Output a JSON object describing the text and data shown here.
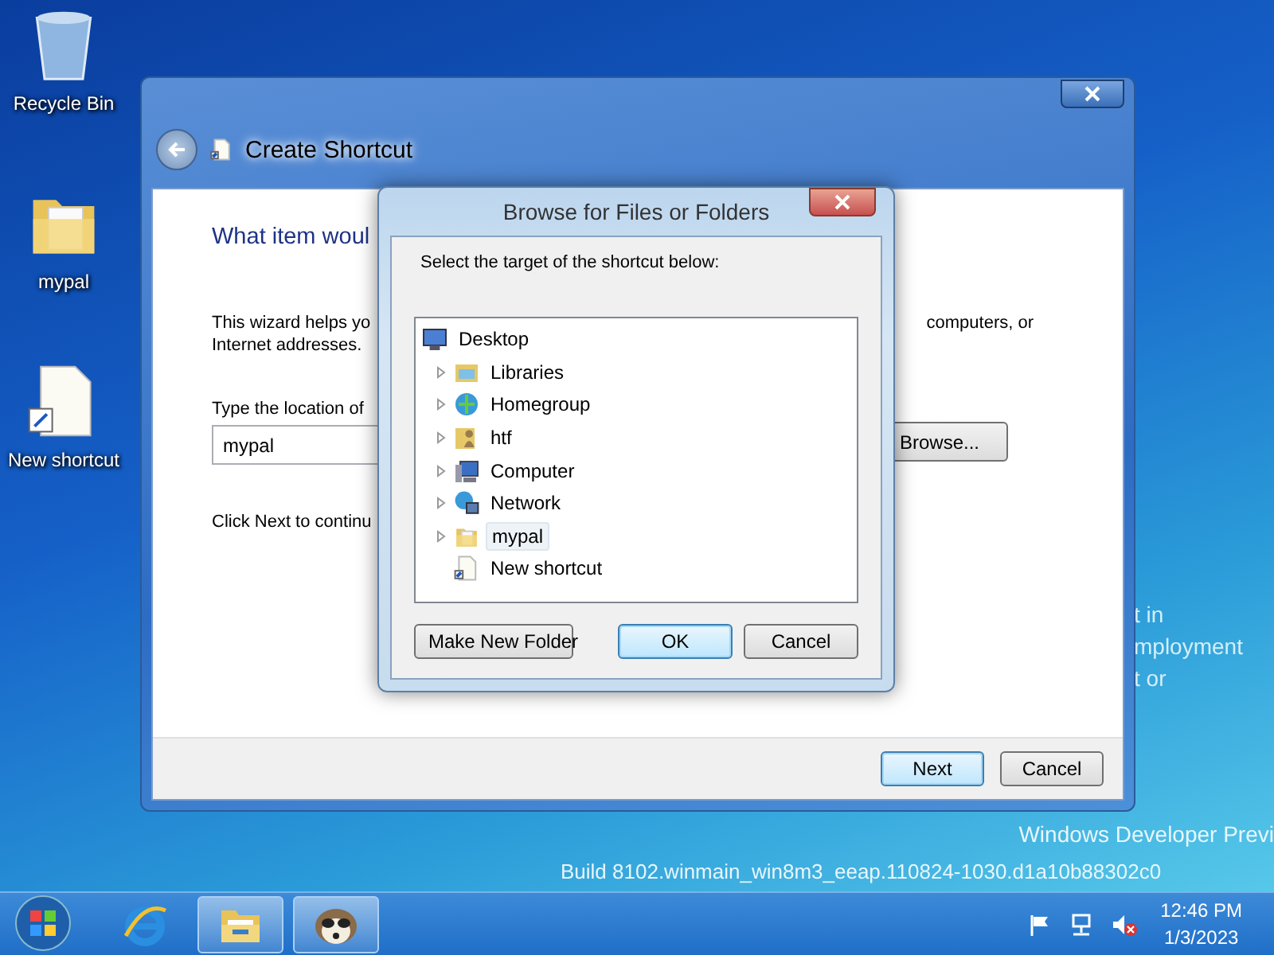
{
  "desktop_icons": [
    {
      "kind": "recycle-bin",
      "label": "Recycle Bin"
    },
    {
      "kind": "folder",
      "label": "mypal"
    },
    {
      "kind": "shortcut",
      "label": "New shortcut"
    }
  ],
  "desktop_text": {
    "fragments": [
      "t in",
      "mployment",
      "t or"
    ],
    "edition": "Windows Developer Previ",
    "build": "Build 8102.winmain_win8m3_eeap.110824-1030.d1a10b88302c0"
  },
  "wizard": {
    "title": "Create Shortcut",
    "heading": "What item woul",
    "intro_left": "This wizard helps yo",
    "intro_right": "computers, or",
    "intro_line2": "Internet addresses.",
    "location_label": "Type the location of",
    "location_value": "mypal",
    "browse_button": "Browse...",
    "continue_text": "Click Next to continu",
    "buttons": [
      {
        "label": "Next",
        "default": true
      },
      {
        "label": "Cancel",
        "default": false
      }
    ]
  },
  "browse_dialog": {
    "title": "Browse for Files or Folders",
    "prompt": "Select the target of the shortcut below:",
    "tree": [
      {
        "kind": "desktop",
        "label": "Desktop",
        "expanded": true,
        "highlighted": false,
        "children": [
          {
            "kind": "libraries",
            "label": "Libraries",
            "expandable": true,
            "highlighted": false
          },
          {
            "kind": "homegroup",
            "label": "Homegroup",
            "expandable": true,
            "highlighted": false
          },
          {
            "kind": "user",
            "label": "htf",
            "expandable": true,
            "highlighted": false
          },
          {
            "kind": "computer",
            "label": "Computer",
            "expandable": true,
            "highlighted": false
          },
          {
            "kind": "network",
            "label": "Network",
            "expandable": true,
            "highlighted": false
          },
          {
            "kind": "folder",
            "label": "mypal",
            "expandable": true,
            "highlighted": true
          },
          {
            "kind": "shortcut",
            "label": "New shortcut",
            "expandable": false,
            "highlighted": false
          }
        ]
      }
    ],
    "buttons": [
      {
        "label": "Make New Folder",
        "default": false
      },
      {
        "label": "OK",
        "default": true
      },
      {
        "label": "Cancel",
        "default": false
      }
    ]
  },
  "taskbar": {
    "items": [
      {
        "kind": "browser",
        "running": false
      },
      {
        "kind": "explorer",
        "running": true
      },
      {
        "kind": "raccoon",
        "running": true
      }
    ],
    "tray": [
      {
        "kind": "flag"
      },
      {
        "kind": "network"
      },
      {
        "kind": "volume-muted"
      }
    ],
    "time": "12:46 PM",
    "date": "1/3/2023"
  }
}
